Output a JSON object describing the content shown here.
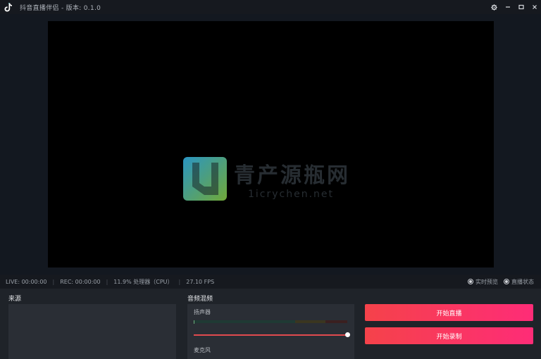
{
  "window": {
    "title": "抖音直播伴侣 - 版本: 0.1.0",
    "controls": {
      "settings_icon": "gear-icon",
      "minimize_icon": "minimize-icon",
      "maximize_icon": "maximize-icon",
      "close_icon": "close-icon"
    }
  },
  "watermark": {
    "cn": "青产源瓶网",
    "en": "1icrychen.net"
  },
  "status": {
    "live": "LIVE: 00:00:00",
    "rec": "REC: 00:00:00",
    "cpu": "11.9% 处理器（CPU）",
    "fps": "27.10 FPS",
    "radio_1": "实时预览",
    "radio_2": "直播状态"
  },
  "panels": {
    "source_title": "来源",
    "mixer_title": "音频混频",
    "mixer_channel_1": "扬声器",
    "mixer_channel_2": "麦克风"
  },
  "actions": {
    "start_live": "开始直播",
    "start_record": "开始录制"
  },
  "colors": {
    "accent_start": "#f5424a",
    "accent_end": "#fe2c77",
    "background": "#16191f"
  }
}
